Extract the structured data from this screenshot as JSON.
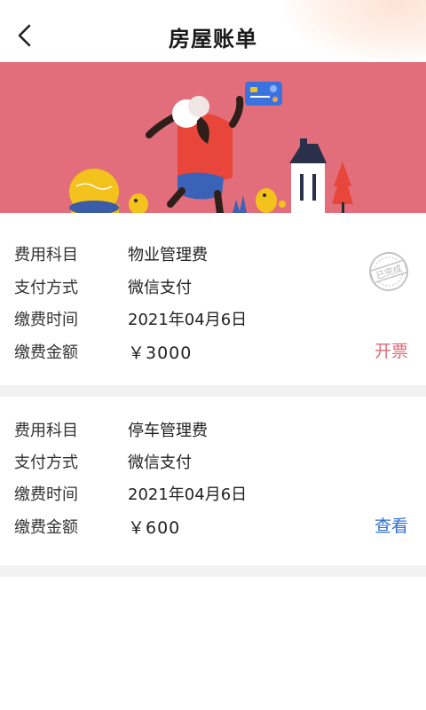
{
  "header": {
    "title": "房屋账单"
  },
  "icons": {
    "back": "chevron-left-icon",
    "stamp": "paid-stamp-icon"
  },
  "bills": [
    {
      "rows": [
        {
          "label": "费用科目",
          "value": "物业管理费"
        },
        {
          "label": "支付方式",
          "value": "微信支付"
        },
        {
          "label": "缴费时间",
          "value": "2021年04月6日"
        },
        {
          "label": "缴费金额",
          "value": "￥3000"
        }
      ],
      "action": "开票",
      "stamp": "已完成"
    },
    {
      "rows": [
        {
          "label": "费用科目",
          "value": "停车管理费"
        },
        {
          "label": "支付方式",
          "value": "微信支付"
        },
        {
          "label": "缴费时间",
          "value": "2021年04月6日"
        },
        {
          "label": "缴费金额",
          "value": "￥600"
        }
      ],
      "action": "查看"
    }
  ],
  "colors": {
    "banner": "#e26e7b",
    "invoice_action": "#e06a78",
    "view_action": "#2f6fd1",
    "divider": "#f2f2f2"
  }
}
